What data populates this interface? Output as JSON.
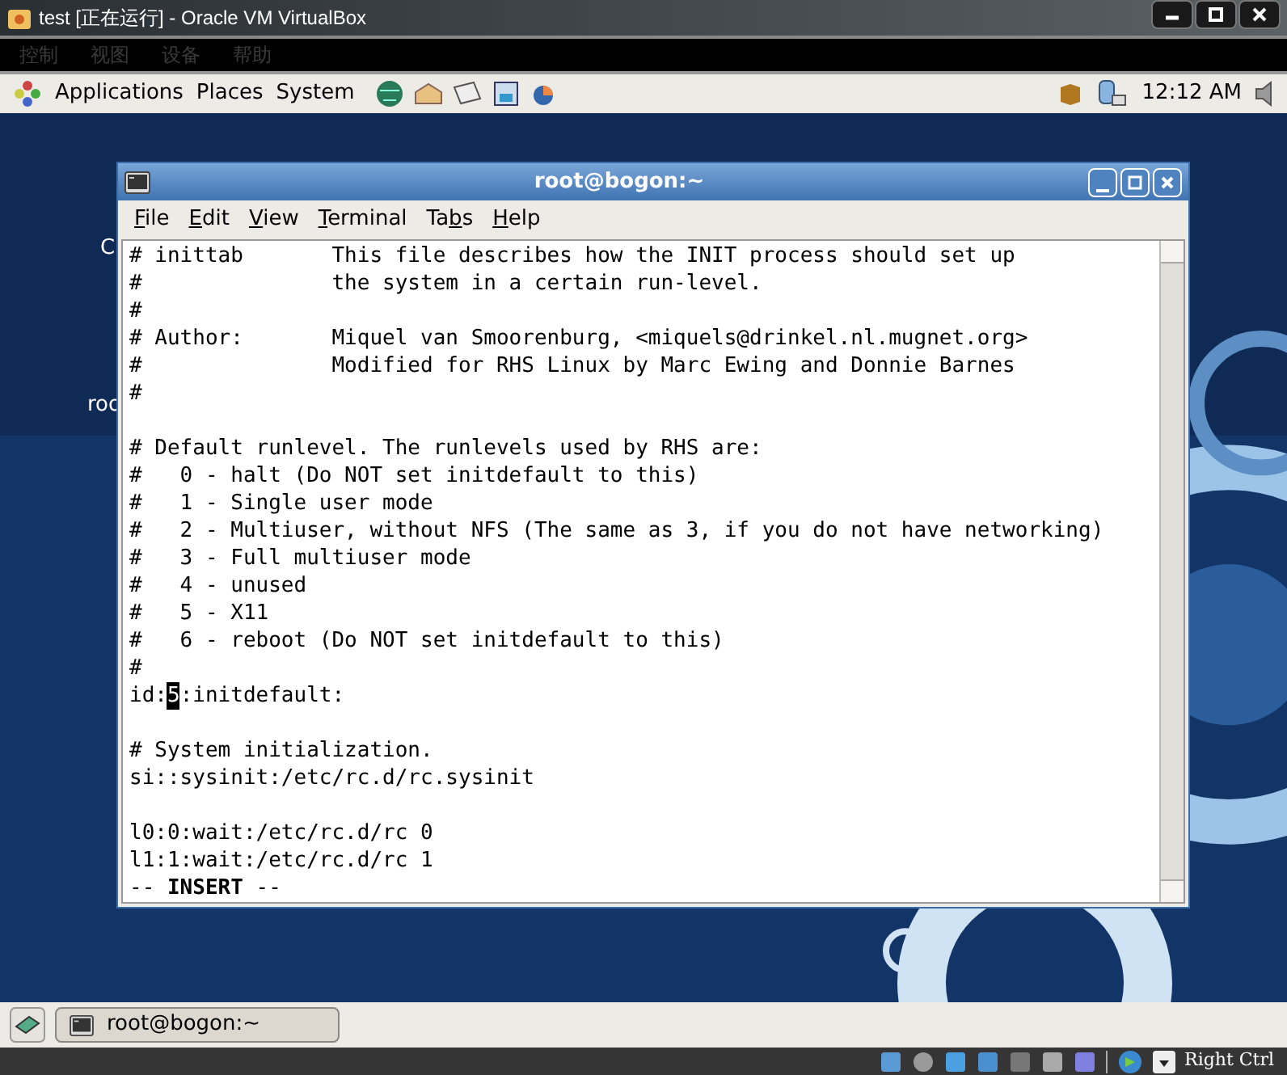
{
  "host_window": {
    "title": "test [正在运行] - Oracle VM VirtualBox"
  },
  "host_menu": [
    {
      "label": "控制",
      "disabled": true
    },
    {
      "label": "视图",
      "disabled": true
    },
    {
      "label": "设备",
      "disabled": true
    },
    {
      "label": "帮助",
      "disabled": true
    }
  ],
  "top_panel": {
    "menus": [
      "Applications",
      "Places",
      "System"
    ],
    "clock": "12:12 AM"
  },
  "desktop_icons": [
    {
      "label": "C"
    },
    {
      "label": "roo"
    }
  ],
  "terminal": {
    "title": "root@bogon:~",
    "menu": [
      {
        "key": "F",
        "post": "ile"
      },
      {
        "key": "E",
        "post": "dit"
      },
      {
        "key": "V",
        "post": "iew"
      },
      {
        "key": "T",
        "post": "erminal"
      },
      {
        "pre": "Ta",
        "key": "b",
        "post": "s"
      },
      {
        "key": "H",
        "post": "elp"
      }
    ],
    "lines": [
      {
        "kind": "text",
        "text": "# inittab       This file describes how the INIT process should set up"
      },
      {
        "kind": "text",
        "text": "#               the system in a certain run-level."
      },
      {
        "kind": "text",
        "text": "#"
      },
      {
        "kind": "text",
        "text": "# Author:       Miquel van Smoorenburg, <miquels@drinkel.nl.mugnet.org>"
      },
      {
        "kind": "text",
        "text": "#               Modified for RHS Linux by Marc Ewing and Donnie Barnes"
      },
      {
        "kind": "text",
        "text": "#"
      },
      {
        "kind": "blank"
      },
      {
        "kind": "text",
        "text": "# Default runlevel. The runlevels used by RHS are:"
      },
      {
        "kind": "text",
        "text": "#   0 - halt (Do NOT set initdefault to this)"
      },
      {
        "kind": "text",
        "text": "#   1 - Single user mode"
      },
      {
        "kind": "text",
        "text": "#   2 - Multiuser, without NFS (The same as 3, if you do not have networking)"
      },
      {
        "kind": "text",
        "text": "#   3 - Full multiuser mode"
      },
      {
        "kind": "text",
        "text": "#   4 - unused"
      },
      {
        "kind": "text",
        "text": "#   5 - X11"
      },
      {
        "kind": "text",
        "text": "#   6 - reboot (Do NOT set initdefault to this)"
      },
      {
        "kind": "text",
        "text": "#"
      },
      {
        "kind": "cursor",
        "before": "id:",
        "cursor": "5",
        "after": ":initdefault:"
      },
      {
        "kind": "blank"
      },
      {
        "kind": "text",
        "text": "# System initialization."
      },
      {
        "kind": "text",
        "text": "si::sysinit:/etc/rc.d/rc.sysinit"
      },
      {
        "kind": "blank"
      },
      {
        "kind": "text",
        "text": "l0:0:wait:/etc/rc.d/rc 0"
      },
      {
        "kind": "text",
        "text": "l1:1:wait:/etc/rc.d/rc 1"
      },
      {
        "kind": "text",
        "text": "-- **INSERT** --"
      }
    ]
  },
  "taskbar": [
    {
      "label": "root@bogon:~",
      "selected": false
    }
  ],
  "status_bar": {
    "host_key": "Right Ctrl"
  }
}
